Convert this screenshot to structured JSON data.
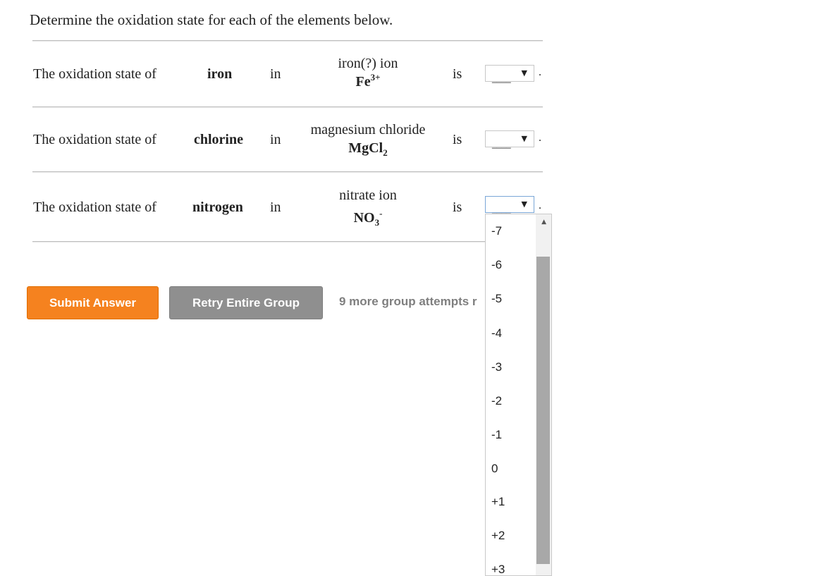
{
  "intro": "Determine the oxidation state for each of the elements below.",
  "rows": [
    {
      "lead": "The oxidation state of",
      "element": "iron",
      "in": "in",
      "compound_name": "iron(?) ion",
      "formula_main": "Fe",
      "formula_sup": "3+",
      "formula_sub": "",
      "is": "is",
      "selected": "____",
      "period": "."
    },
    {
      "lead": "The oxidation state of",
      "element": "chlorine",
      "in": "in",
      "compound_name": "magnesium chloride",
      "formula_main": "MgCl",
      "formula_sup": "",
      "formula_sub": "2",
      "is": "is",
      "selected": "____",
      "period": "."
    },
    {
      "lead": "The oxidation state of",
      "element": "nitrogen",
      "in": "in",
      "compound_name": "nitrate ion",
      "formula_main": "NO",
      "formula_sup": "-",
      "formula_sub": "3",
      "is": "is",
      "selected": "____",
      "period": "."
    }
  ],
  "buttons": {
    "submit": "Submit Answer",
    "retry": "Retry Entire Group"
  },
  "attempts_text": "9 more group attempts r",
  "dropdown_options": [
    "-7",
    "-6",
    "-5",
    "-4",
    "-3",
    "-2",
    "-1",
    "0",
    "+1",
    "+2",
    "+3"
  ],
  "colors": {
    "submit": "#f5821f",
    "retry": "#8f8f8f",
    "attempts": "#7f7f7f"
  }
}
